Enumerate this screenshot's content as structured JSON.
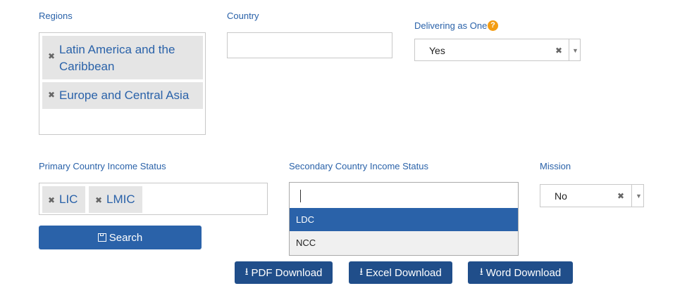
{
  "regions": {
    "label": "Regions",
    "tags": [
      "Latin America and the Caribbean",
      "Europe and Central Asia"
    ]
  },
  "country": {
    "label": "Country",
    "value": ""
  },
  "delivering_as_one": {
    "label": "Delivering as One",
    "value": "Yes",
    "help": "?"
  },
  "primary_income": {
    "label": "Primary Country Income Status",
    "tags": [
      "LIC",
      "LMIC"
    ]
  },
  "secondary_income": {
    "label": "Secondary Country Income Status",
    "input_value": "",
    "options": [
      "LDC",
      "NCC"
    ],
    "highlighted": "LDC"
  },
  "mission": {
    "label": "Mission",
    "value": "No"
  },
  "search_label": "Search",
  "downloads": {
    "pdf_label": "PDF Download",
    "excel_label": "Excel Download",
    "word_label": "Word Download"
  },
  "colors": {
    "accent": "#2a62a9",
    "download_bg": "#204e8a",
    "tag_bg": "#e5e5e5",
    "help_icon": "#f39c12"
  }
}
